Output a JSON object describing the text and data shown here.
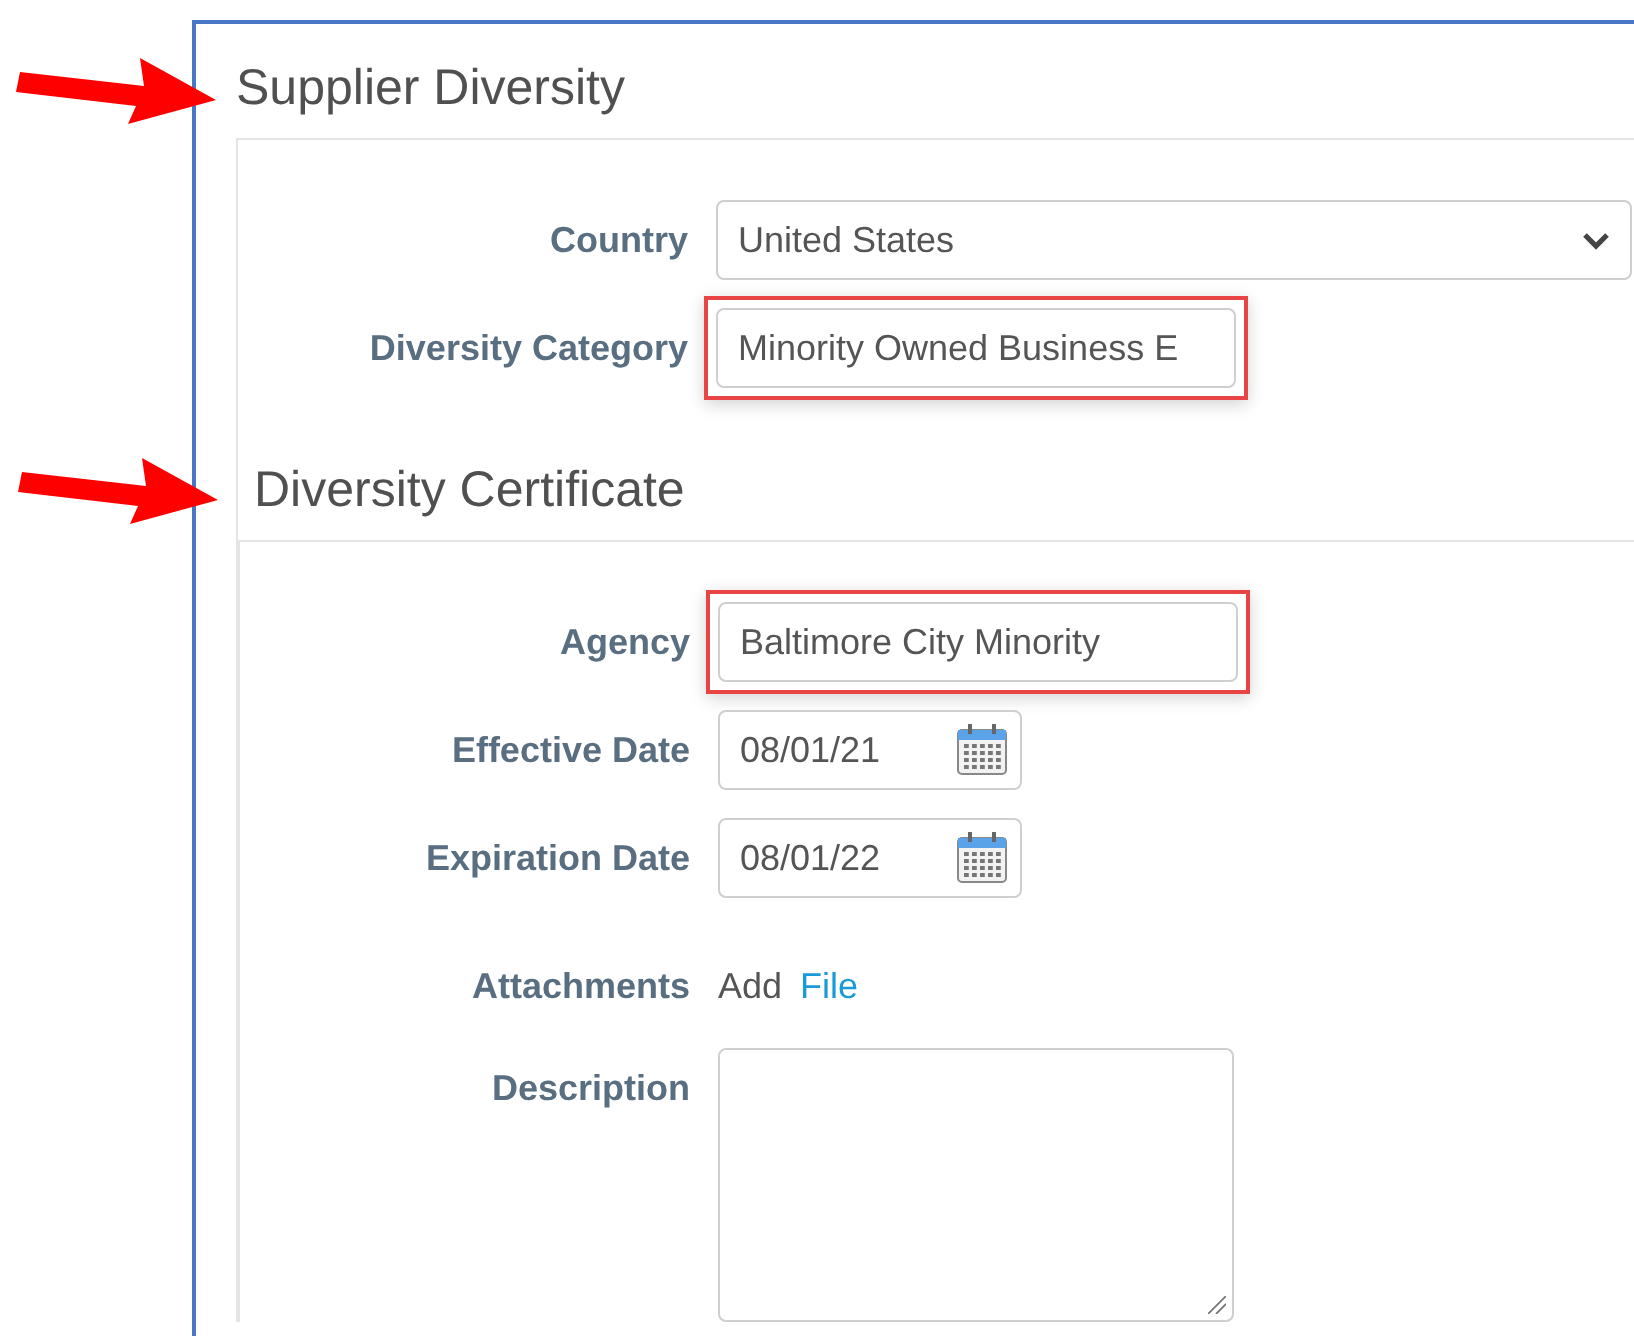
{
  "section": {
    "title": "Supplier Diversity",
    "pointed": true,
    "fields": [
      {
        "kind": "select",
        "label": "Country",
        "value": "United States",
        "highlighted": false
      },
      {
        "kind": "text",
        "label": "Diversity Category",
        "value": "Minority Owned Business E",
        "highlighted": true
      }
    ],
    "sections": [
      {
        "title": "Diversity Certificate",
        "pointed": true,
        "fields": [
          {
            "kind": "text",
            "label": "Agency",
            "value": "Baltimore City Minority",
            "highlighted": true
          },
          {
            "kind": "date",
            "label": "Effective Date",
            "value": "08/01/21",
            "highlighted": false
          },
          {
            "kind": "date",
            "label": "Expiration Date",
            "value": "08/01/22",
            "highlighted": false
          },
          {
            "kind": "attachments",
            "label": "Attachments",
            "text": "Add",
            "link": "File"
          },
          {
            "kind": "textarea",
            "label": "Description",
            "highlighted": false
          }
        ]
      }
    ]
  }
}
